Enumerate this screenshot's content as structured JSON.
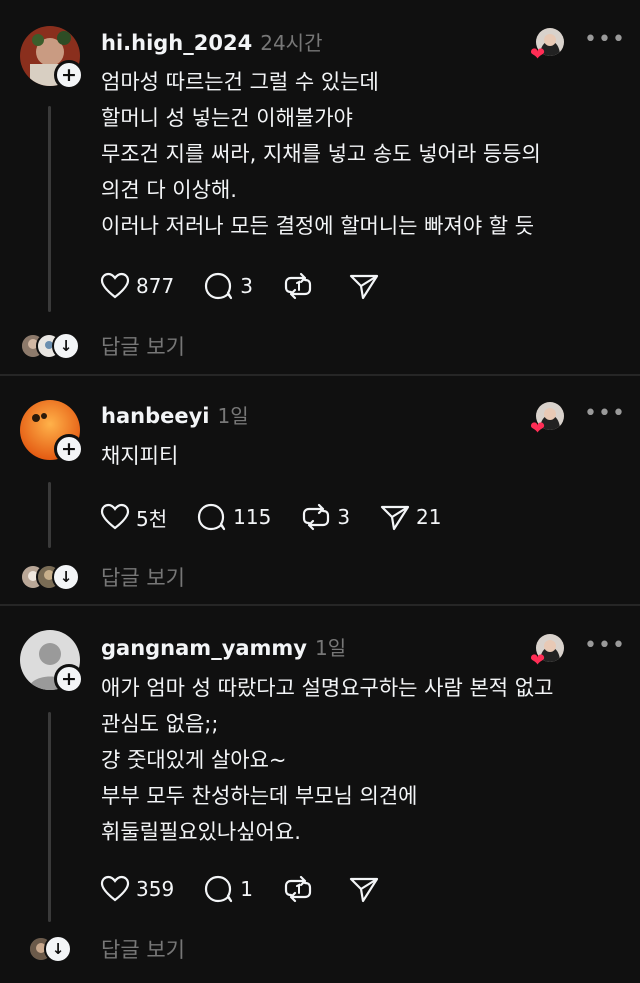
{
  "posts": [
    {
      "username": "hi.high_2024",
      "time": "24시간",
      "body": "엄마성 따르는건 그럴 수 있는데\n할머니 성 넣는건 이해불가야\n무조건 지를 써라, 지채를 넣고 송도 넣어라 등등의\n의견 다 이상해.\n이러나 저러나 모든 결정에 할머니는 빠져야 할 듯",
      "likes": "877",
      "comments": "3",
      "reposts": "",
      "shares": "",
      "replies_label": "답글 보기"
    },
    {
      "username": "hanbeeyi",
      "time": "1일",
      "body": "채지피티",
      "likes": "5천",
      "comments": "115",
      "reposts": "3",
      "shares": "21",
      "replies_label": "답글 보기"
    },
    {
      "username": "gangnam_yammy",
      "time": "1일",
      "body": "애가 엄마 성 따랐다고 설명요구하는 사람 본적 없고\n관심도 없음;;\n걍 줏대있게 살아요~\n부부 모두 찬성하는데 부모님 의견에\n휘둘릴필요있나싶어요.",
      "likes": "359",
      "comments": "1",
      "reposts": "",
      "shares": "",
      "replies_label": "답글 보기"
    }
  ],
  "icons": {
    "more": "more-horizontal-icon",
    "like": "heart-icon",
    "comment": "comment-icon",
    "repost": "repost-icon",
    "share": "send-icon",
    "follow": "plus-icon",
    "expand": "arrow-down-icon"
  },
  "colors": {
    "background": "#101010",
    "text": "#f3f5f7",
    "muted": "#777777",
    "heart": "#ff2d55"
  }
}
